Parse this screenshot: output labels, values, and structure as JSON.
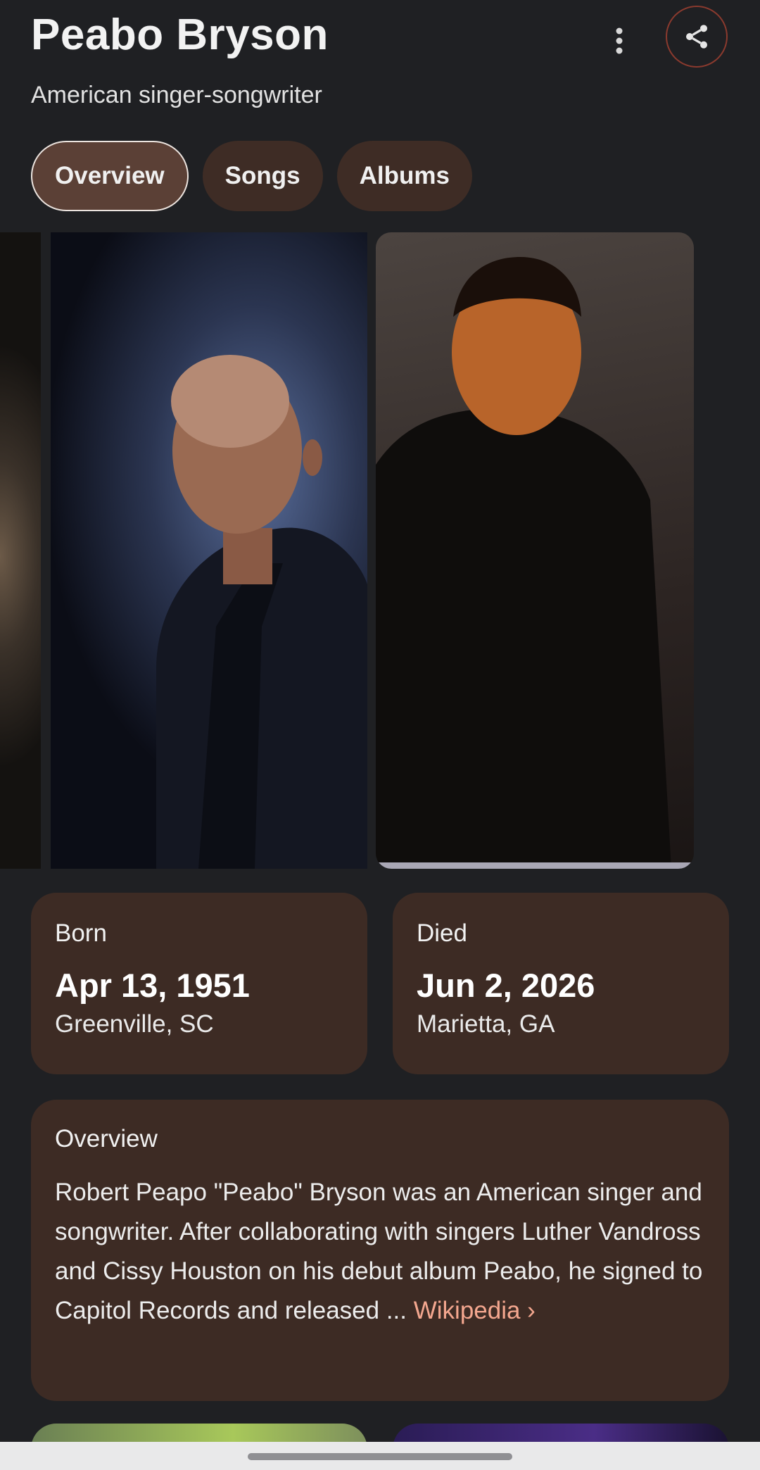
{
  "header": {
    "title": "Peabo Bryson",
    "subtitle": "American singer-songwriter",
    "more_icon": "more-vert-icon",
    "share_icon": "share-icon"
  },
  "tabs": [
    {
      "label": "Overview",
      "active": true
    },
    {
      "label": "Songs",
      "active": false
    },
    {
      "label": "Albums",
      "active": false
    }
  ],
  "born": {
    "label": "Born",
    "date": "Apr 13, 1951",
    "place": "Greenville, SC"
  },
  "died": {
    "label": "Died",
    "date": "Jun 2, 2026",
    "place": "Marietta, GA"
  },
  "overview": {
    "heading": "Overview",
    "text": "Robert Peapo \"Peabo\" Bryson was an American singer and songwriter. After collaborating with singers Luther Vandross and Cissy Houston on his debut album Peabo, he signed to Capitol Records and released ... ",
    "link_label": "Wikipedia ›"
  },
  "colors": {
    "background": "#1f2023",
    "card": "#3d2b24",
    "chip": "#3e2c25",
    "chip_active": "#5b4036",
    "link": "#f4a78f",
    "share_ring": "#8b3a2e"
  }
}
